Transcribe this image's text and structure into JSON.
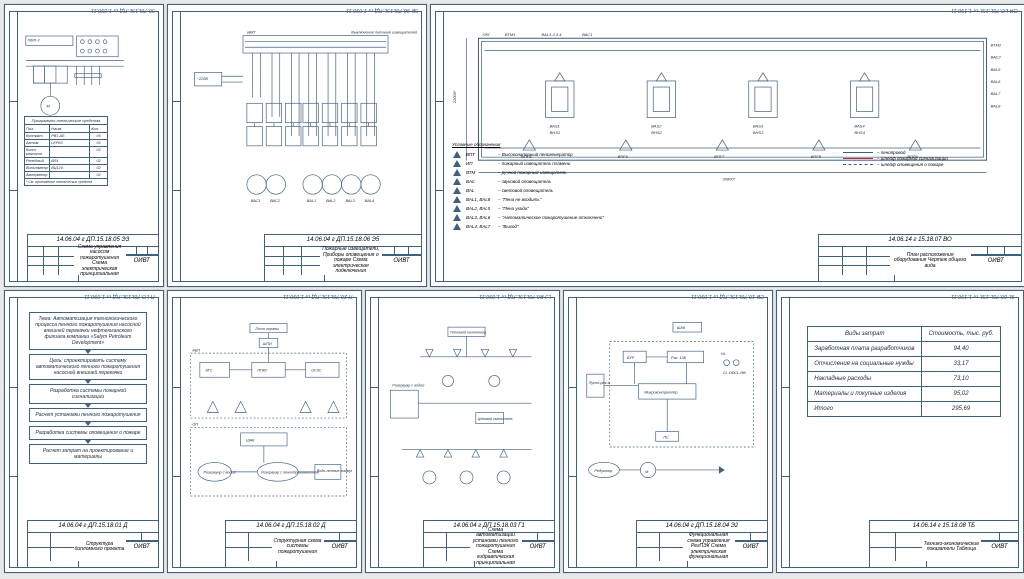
{
  "org": "ОИВТ",
  "sheets": {
    "s05": {
      "top_code": "50.78L15L.ПД т 1.090.11",
      "doc_code": "14.06.04 г ДП.15.18.05 ЭЗ",
      "title": "Схема управления насосом пожаротушения\nСхема электрическая принципиальная"
    },
    "s06": {
      "top_code": "5Е 90.78L15L.ПД т 1.090.11",
      "doc_code": "14.06.04 г ДП.15.18.06 Э5",
      "title": "Пожарные извещатели,\nПриборы оповещения о пожаре\nСхема электрическая подключения",
      "labels": {
        "controller": "вВКГ",
        "sign": "Выключение питания извещателей"
      }
    },
    "s07": {
      "top_code": "ОЯ LO.78L.15L т 1.190.11",
      "doc_code": "14.06.14 г 15.18.07 ВО",
      "title": "План расположения\nоборудования\nЧертеж общего вида",
      "legend_heading": "Условные обозначения",
      "legend": [
        {
          "sym": "ВПТ",
          "txt": "– Высоконапорный пеногенератор"
        },
        {
          "sym": "ИП",
          "txt": "– пожарный извещатель пламени"
        },
        {
          "sym": "ВТМ",
          "txt": "– ручной пожарный извещатель"
        },
        {
          "sym": "ВАС",
          "txt": "– звуковой оповещатель"
        },
        {
          "sym": "ВАL",
          "txt": "– световой оповещатель"
        },
        {
          "sym": "ВАL1, ВАL8",
          "txt": "– \"Пена не входить\""
        },
        {
          "sym": "ВАL2, ВАL5",
          "txt": "– \"Пена уходи\""
        },
        {
          "sym": "ВАL3, ВАL6",
          "txt": "– \"Автоматическое пожаротушение отключено\""
        },
        {
          "sym": "ВАL4, ВАL7",
          "txt": "– \"Выход\""
        }
      ],
      "line_legend": [
        {
          "cls": "solid",
          "txt": "– пенопровод"
        },
        {
          "cls": "red",
          "txt": "– шлейф пожарной сигнализации"
        },
        {
          "cls": "dash",
          "txt": "– шлейф оповещения о пожаре"
        }
      ],
      "dim_h": "12000*",
      "dim_w": "30800*",
      "plan_labels": [
        "ВТМ1",
        "ВАL1.2.3.4",
        "ВАС1",
        "ВПГ1",
        "ВПГ2",
        "ВПГ3",
        "ВПГ4",
        "ВАL5",
        "ВАС2",
        "ВТМ2",
        "ВАL6",
        "ВАL7",
        "ВАL8",
        "ВША1",
        "ВША2",
        "ВША3",
        "ВША4",
        "ВША5",
        "ВПГ5",
        "ВПГ6",
        "ВПГ7",
        "ВПГ8",
        "ВПГ9"
      ],
      "pump_labels": [
        "ВАS1",
        "ВHS1",
        "ВАS2",
        "ВHS2",
        "ВАS3",
        "ВHS3",
        "ВАS4",
        "ВHS4"
      ]
    },
    "s01": {
      "top_code": "П LO.78L15L.ПД т 1.090.11",
      "doc_code": "14.06.04 г ДП.15.18.01 Д",
      "title": "Структура\nдипломного проекта",
      "theme": "Тема: Автоматизация технологического процесса пенного пожаротушения насосной внешней перекачки нефтеюганского филиала компании «Salym Petroleum Development»",
      "goal": "Цель: спроектировать систему автоматического пенного пожаротушения насосной внешней перекачки",
      "steps": [
        "Разработка системы пожарной сигнализации",
        "Расчет установки пенного пожаротушения",
        "Разработка системы оповещения о пожаре",
        "Расчет затрат на проектирование и материалы"
      ]
    },
    "s02": {
      "top_code": "П 20.78L15L.ПД т 1.090.11",
      "doc_code": "14.06.04 г ДП.15.18.02 Д",
      "title": "Структурная\nсхема системы\nпожаротушения",
      "labels": {
        "post": "Пост охраны",
        "shpi": "ШПИ",
        "ats": "АТС",
        "oues": "ОУЭС",
        "ppku": "ППКУ",
        "shak": "ШАК",
        "res1": "Резервуар с водой",
        "res2": "Резервуар с пенообразователем",
        "pump": "Водо-пенные коммуникации"
      }
    },
    "s03": {
      "top_code": "LJ E0.78L15L.ПД т 1.090.11",
      "doc_code": "14.06.04 г ДП.15.18.03 Г1",
      "title": "Схема автоматизации установки пенного пожаротушения\nСхема гидравлическая принципиальная",
      "labels": {
        "res": "Резервуар с водой",
        "manifold": "Тепловой коллектор",
        "tank": "Пеноконцентрат",
        "mix": "Цеховой смеситель"
      }
    },
    "s04": {
      "top_code": "СЕ 10.78L15L.ПД т 1.090.11",
      "doc_code": "14.06.04 г ДП.15.18.04 Э2",
      "title": "Функциональная схема\nуправления РегПЭК\nСхема электрическая функциональная",
      "labels": {
        "pusk": "Пуско-рег-я",
        "reg": "Редуктор",
        "m": "М",
        "plc": "Микроконтроллер",
        "bur": "БУР",
        "rm": "Рэк. 13К",
        "shak": "ШАК",
        "hl": "HL",
        "cld": "CL-HD",
        "clh": "CL-HB"
      }
    },
    "s08": {
      "top_code": "9L 80.78L.15L т 1.190.11",
      "doc_code": "14.06.14 г 15.18.08 ТБ",
      "title": "Технико-экономические\nпоказатели\nТаблица"
    }
  },
  "chart_data": {
    "type": "table",
    "title": "Технико-экономические показатели",
    "columns": [
      "Виды затрат",
      "Стоимость, тыс. руб."
    ],
    "rows": [
      [
        "Заработная плата разработчиков",
        "94,40"
      ],
      [
        "Отчисления на социальные нужды",
        "33,17"
      ],
      [
        "Накладные расходы",
        "73,10"
      ],
      [
        "Материалы и покупные изделия",
        "95,02"
      ],
      [
        "Итого",
        "295,69"
      ]
    ]
  },
  "spec_table": {
    "title": "Программно-технические средства",
    "cols": [
      "Поз.",
      "Наим.",
      "Кол."
    ],
    "rows": [
      [
        "Контакт",
        "PB1-AE.",
        "06"
      ],
      [
        "Автом.",
        "LEP63",
        "02"
      ],
      [
        "Конт. магнитн.",
        "",
        "02"
      ],
      [
        "Релейный",
        "ВЛ4",
        "02"
      ],
      [
        "Вольтметр",
        "ВЦ120.",
        "02"
      ],
      [
        "Амперметр",
        "",
        "02"
      ]
    ],
    "footer": "* См. приложение технических средств"
  }
}
